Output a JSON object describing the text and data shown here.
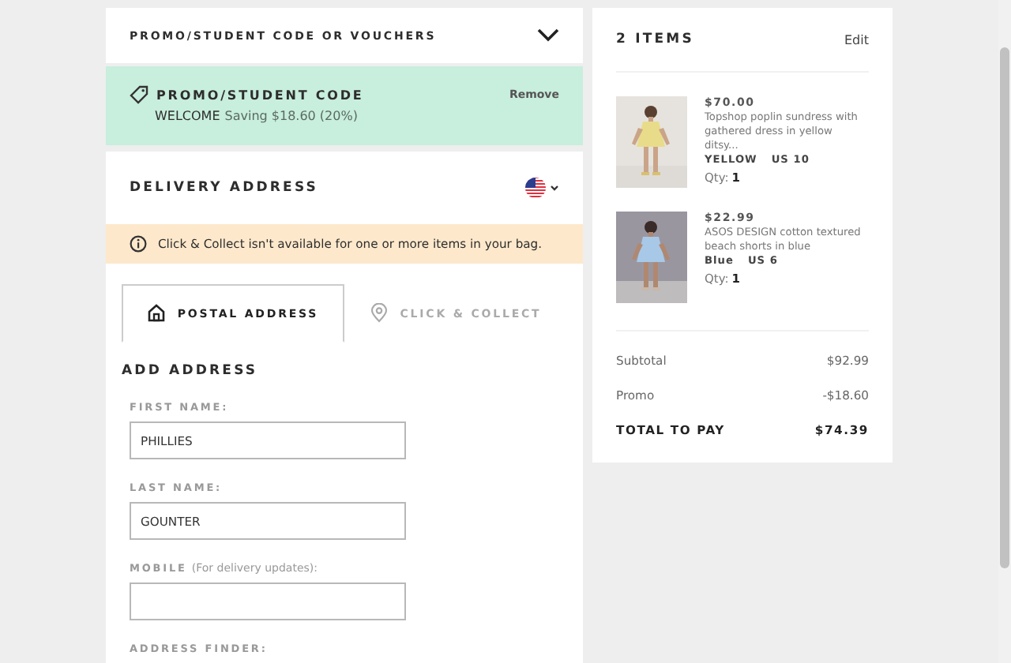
{
  "promo_section": {
    "title": "PROMO/STUDENT CODE OR VOUCHERS"
  },
  "applied_promo": {
    "title": "PROMO/STUDENT CODE",
    "code": "WELCOME",
    "saving": "Saving $18.60 (20%)",
    "action": "Remove"
  },
  "delivery": {
    "title": "DELIVERY ADDRESS",
    "notice": "Click & Collect isn't available for one or more items in your bag.",
    "tabs": [
      {
        "label": "POSTAL ADDRESS",
        "kind": "postal",
        "selected": true
      },
      {
        "label": "CLICK & COLLECT",
        "kind": "collect",
        "selected": false
      }
    ],
    "form_title": "ADD ADDRESS",
    "fields": [
      {
        "kind": "input",
        "label": "FIRST NAME:",
        "value": "PHILLIES"
      },
      {
        "kind": "input",
        "label": "LAST NAME:",
        "value": "GOUNTER"
      },
      {
        "kind": "input",
        "label": "MOBILE",
        "hint": "(For delivery updates):"
      },
      {
        "kind": "label",
        "label": "ADDRESS FINDER:"
      }
    ]
  },
  "bag": {
    "title": "2 ITEMS",
    "action": "Edit",
    "items": [
      {
        "price": "$70.00",
        "name": "Topshop poplin sundress with gathered dress in yellow ditsy...",
        "colour": "YELLOW",
        "size": "US 10",
        "qty_label": "Qty:",
        "qty": "1",
        "kind": "yellow"
      },
      {
        "price": "$22.99",
        "name": "ASOS DESIGN cotton textured beach shorts in blue",
        "colour": "Blue",
        "size": "US 6",
        "qty_label": "Qty:",
        "qty": "1",
        "kind": "blue"
      }
    ],
    "totals": [
      {
        "kind": "line",
        "label": "Subtotal",
        "value": "$92.99"
      },
      {
        "kind": "line",
        "label": "Promo",
        "value": "-$18.60"
      },
      {
        "kind": "total",
        "label": "TOTAL TO PAY",
        "value": "$74.39"
      }
    ]
  }
}
